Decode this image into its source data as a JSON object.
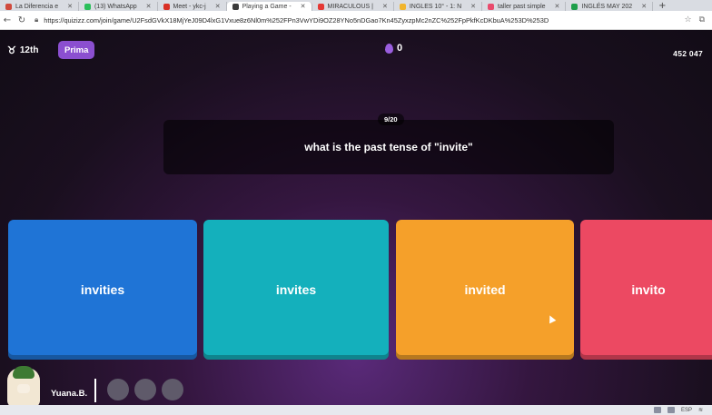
{
  "browser": {
    "tabs": [
      {
        "label": "La Diferencia e",
        "color": "#d04a3c"
      },
      {
        "label": "(13) WhatsApp",
        "color": "#2bbf5a"
      },
      {
        "label": "Meet - ykc-j",
        "color": "#d93025"
      },
      {
        "label": "Playing a Game -",
        "color": "#3a3a3a",
        "active": true
      },
      {
        "label": "MIRACULOUS |",
        "color": "#e53935"
      },
      {
        "label": "INGLES 10° - 1: N",
        "color": "#f1b52d"
      },
      {
        "label": "taller past simple",
        "color": "#e94b6d"
      },
      {
        "label": "INGLÉS MAY 202",
        "color": "#1e9e4a"
      }
    ],
    "url": "https://quizizz.com/join/game/U2FsdGVkX18MjYeJ09D4lxG1Vxue8z6Nl0m%252FPn3VwYDi9OZ28YNo5nDGao7Kn45ZyxzpMc2nZC%252FpPkfKcDKbuA%253D%253D"
  },
  "game": {
    "rank": "12th",
    "mode": "Prima",
    "streak": "0",
    "score": "452 047",
    "question_count": "9/20",
    "question": "what is the past tense of \"invite\"",
    "options": [
      "invities",
      "invites",
      "invited",
      "invito"
    ],
    "player": "Yuana.B."
  },
  "colors": {
    "option1": "#1f74d6",
    "option2": "#14b0bc",
    "option3": "#f5a02a",
    "option4": "#ec4962",
    "mode_pill": "#8b4fd0"
  },
  "taskbar": {
    "lang": "ESP"
  }
}
